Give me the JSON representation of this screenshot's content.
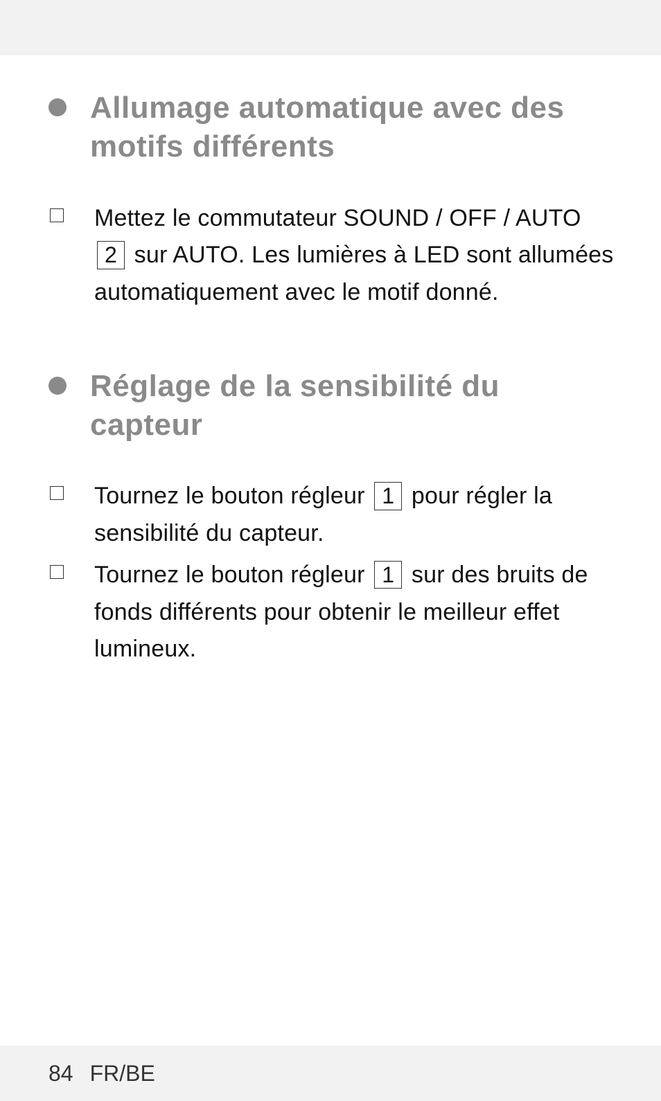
{
  "sections": [
    {
      "heading": "Allumage automatique avec des motifs différents",
      "items": [
        {
          "pre": "Mettez le commutateur SOUND / OFF / AUTO ",
          "ref": "2",
          "post": " sur AUTO. Les lumières à LED sont allumées automatiquement avec le motif donné."
        }
      ]
    },
    {
      "heading": "Réglage de la sensibilité du capteur",
      "items": [
        {
          "pre": "Tournez le bouton régleur ",
          "ref": "1",
          "post": " pour régler la sensibilité du capteur."
        },
        {
          "pre": "Tournez le bouton régleur ",
          "ref": "1",
          "post": " sur des bruits de fonds différents pour obtenir le meilleur effet lumineux."
        }
      ]
    }
  ],
  "footer": {
    "page_number": "84",
    "locale": "FR/BE"
  }
}
